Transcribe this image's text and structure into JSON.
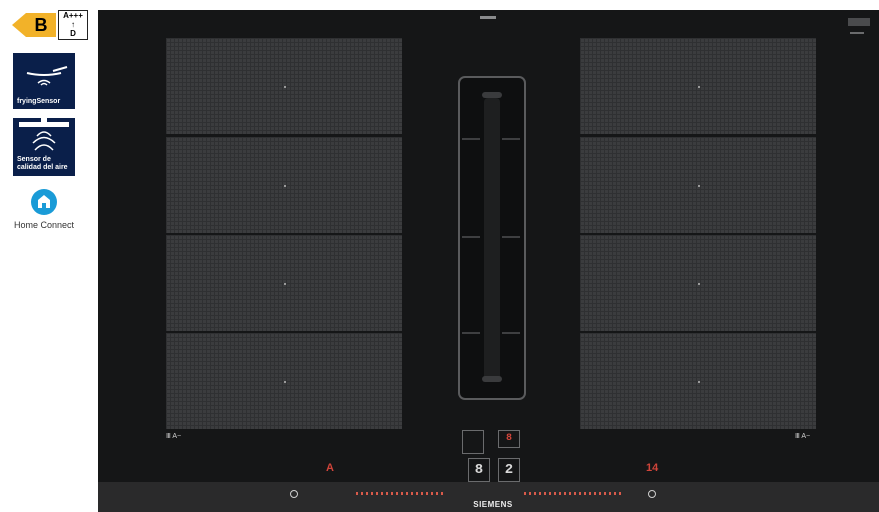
{
  "energy_label": {
    "grade": "B",
    "scale_top": "A+++",
    "scale_bottom": "D",
    "color": "#f2b229"
  },
  "badges": {
    "frying": {
      "label": "fryingSensor",
      "icon": "frying-pan-icon"
    },
    "air": {
      "label_line1": "Sensor de",
      "label_line2": "calidad del aire",
      "icon": "air-quality-icon"
    }
  },
  "home_connect": {
    "label": "Home Connect",
    "icon": "home-connect-icon",
    "color": "#1a9bd7"
  },
  "cooktop": {
    "brand": "SIEMENS",
    "left_indicator": "Ⅲ A−",
    "right_indicator": "Ⅲ A−",
    "display_level": "A",
    "fan_left": "8",
    "fan_right": "2",
    "timer": "14"
  }
}
